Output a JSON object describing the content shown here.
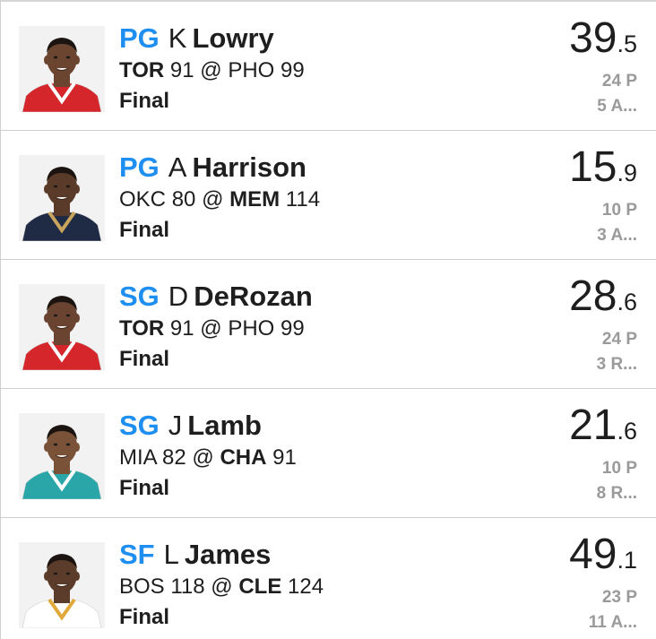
{
  "players": [
    {
      "position": "PG",
      "initial": "K",
      "last_name": "Lowry",
      "matchup": {
        "away": "TOR",
        "away_score": "91",
        "sep": "@",
        "home": "PHO",
        "home_score": "99",
        "bold": "away"
      },
      "status": "Final",
      "points_int": "39",
      "points_dec": ".5",
      "stat1": "24 P",
      "stat2": "5 A...",
      "jersey_color": "#d4262b",
      "jersey_trim": "#ffffff",
      "skin": "#6b4530"
    },
    {
      "position": "PG",
      "initial": "A",
      "last_name": "Harrison",
      "matchup": {
        "away": "OKC",
        "away_score": "80",
        "sep": "@",
        "home": "MEM",
        "home_score": "114",
        "bold": "home"
      },
      "status": "Final",
      "points_int": "15",
      "points_dec": ".9",
      "stat1": "10 P",
      "stat2": "3 A...",
      "jersey_color": "#1f2a44",
      "jersey_trim": "#c9a45c",
      "skin": "#5a3a28"
    },
    {
      "position": "SG",
      "initial": "D",
      "last_name": "DeRozan",
      "matchup": {
        "away": "TOR",
        "away_score": "91",
        "sep": "@",
        "home": "PHO",
        "home_score": "99",
        "bold": "away"
      },
      "status": "Final",
      "points_int": "28",
      "points_dec": ".6",
      "stat1": "24 P",
      "stat2": "3 R...",
      "jersey_color": "#d4262b",
      "jersey_trim": "#ffffff",
      "skin": "#6a4431"
    },
    {
      "position": "SG",
      "initial": "J",
      "last_name": "Lamb",
      "matchup": {
        "away": "MIA",
        "away_score": "82",
        "sep": "@",
        "home": "CHA",
        "home_score": "91",
        "bold": "home"
      },
      "status": "Final",
      "points_int": "21",
      "points_dec": ".6",
      "stat1": "10 P",
      "stat2": "8 R...",
      "jersey_color": "#2aa6a8",
      "jersey_trim": "#ffffff",
      "skin": "#7a5238"
    },
    {
      "position": "SF",
      "initial": "L",
      "last_name": "James",
      "matchup": {
        "away": "BOS",
        "away_score": "118",
        "sep": "@",
        "home": "CLE",
        "home_score": "124",
        "bold": "home"
      },
      "status": "Final",
      "points_int": "49",
      "points_dec": ".1",
      "stat1": "23 P",
      "stat2": "11 A...",
      "jersey_color": "#ffffff",
      "jersey_trim": "#e0a93a",
      "skin": "#5b3b29"
    }
  ]
}
